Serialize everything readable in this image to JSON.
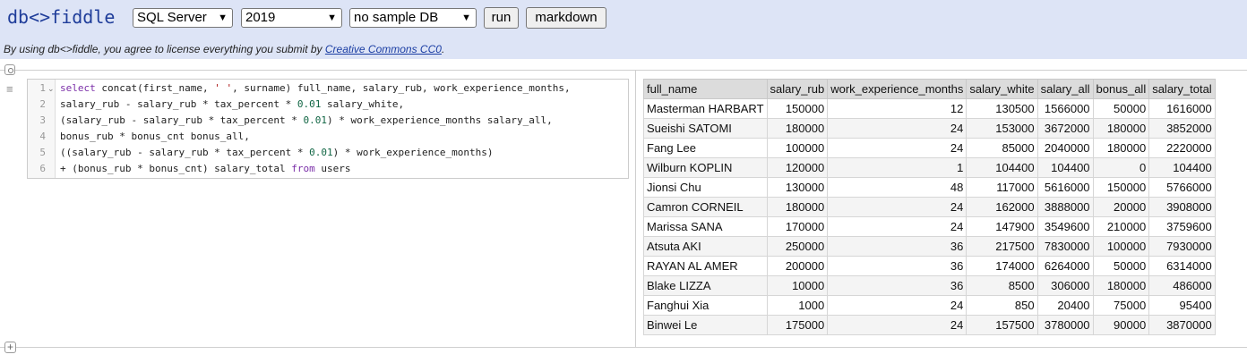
{
  "header": {
    "brand": "db<>fiddle",
    "engine": "SQL Server",
    "version": "2019",
    "sample_db": "no sample DB",
    "run_label": "run",
    "markdown_label": "markdown"
  },
  "license": {
    "prefix": "By using db<>fiddle, you agree to license everything you submit by ",
    "link": "Creative Commons CC0",
    "suffix": "."
  },
  "editor": {
    "line_numbers": [
      "1",
      "2",
      "3",
      "4",
      "5",
      "6"
    ],
    "lines": [
      "select concat(first_name, ' ', surname) full_name, salary_rub, work_experience_months,",
      "salary_rub - salary_rub * tax_percent * 0.01 salary_white,",
      "(salary_rub - salary_rub * tax_percent * 0.01) * work_experience_months salary_all,",
      "bonus_rub * bonus_cnt bonus_all,",
      "((salary_rub - salary_rub * tax_percent * 0.01) * work_experience_months)",
      "+ (bonus_rub * bonus_cnt) salary_total from users"
    ]
  },
  "results": {
    "columns": [
      "full_name",
      "salary_rub",
      "work_experience_months",
      "salary_white",
      "salary_all",
      "bonus_all",
      "salary_total"
    ],
    "rows": [
      [
        "Masterman HARBART",
        "150000",
        "12",
        "130500",
        "1566000",
        "50000",
        "1616000"
      ],
      [
        "Sueishi SATOMI",
        "180000",
        "24",
        "153000",
        "3672000",
        "180000",
        "3852000"
      ],
      [
        "Fang Lee",
        "100000",
        "24",
        "85000",
        "2040000",
        "180000",
        "2220000"
      ],
      [
        "Wilburn KOPLIN",
        "120000",
        "1",
        "104400",
        "104400",
        "0",
        "104400"
      ],
      [
        "Jionsi Chu",
        "130000",
        "48",
        "117000",
        "5616000",
        "150000",
        "5766000"
      ],
      [
        "Camron CORNEIL",
        "180000",
        "24",
        "162000",
        "3888000",
        "20000",
        "3908000"
      ],
      [
        "Marissa SANA",
        "170000",
        "24",
        "147900",
        "3549600",
        "210000",
        "3759600"
      ],
      [
        "Atsuta AKI",
        "250000",
        "36",
        "217500",
        "7830000",
        "100000",
        "7930000"
      ],
      [
        "RAYAN AL AMER",
        "200000",
        "36",
        "174000",
        "6264000",
        "50000",
        "6314000"
      ],
      [
        "Blake LIZZA",
        "10000",
        "36",
        "8500",
        "306000",
        "180000",
        "486000"
      ],
      [
        "Fanghui Xia",
        "1000",
        "24",
        "850",
        "20400",
        "75000",
        "95400"
      ],
      [
        "Binwei Le",
        "175000",
        "24",
        "157500",
        "3780000",
        "90000",
        "3870000"
      ]
    ]
  }
}
